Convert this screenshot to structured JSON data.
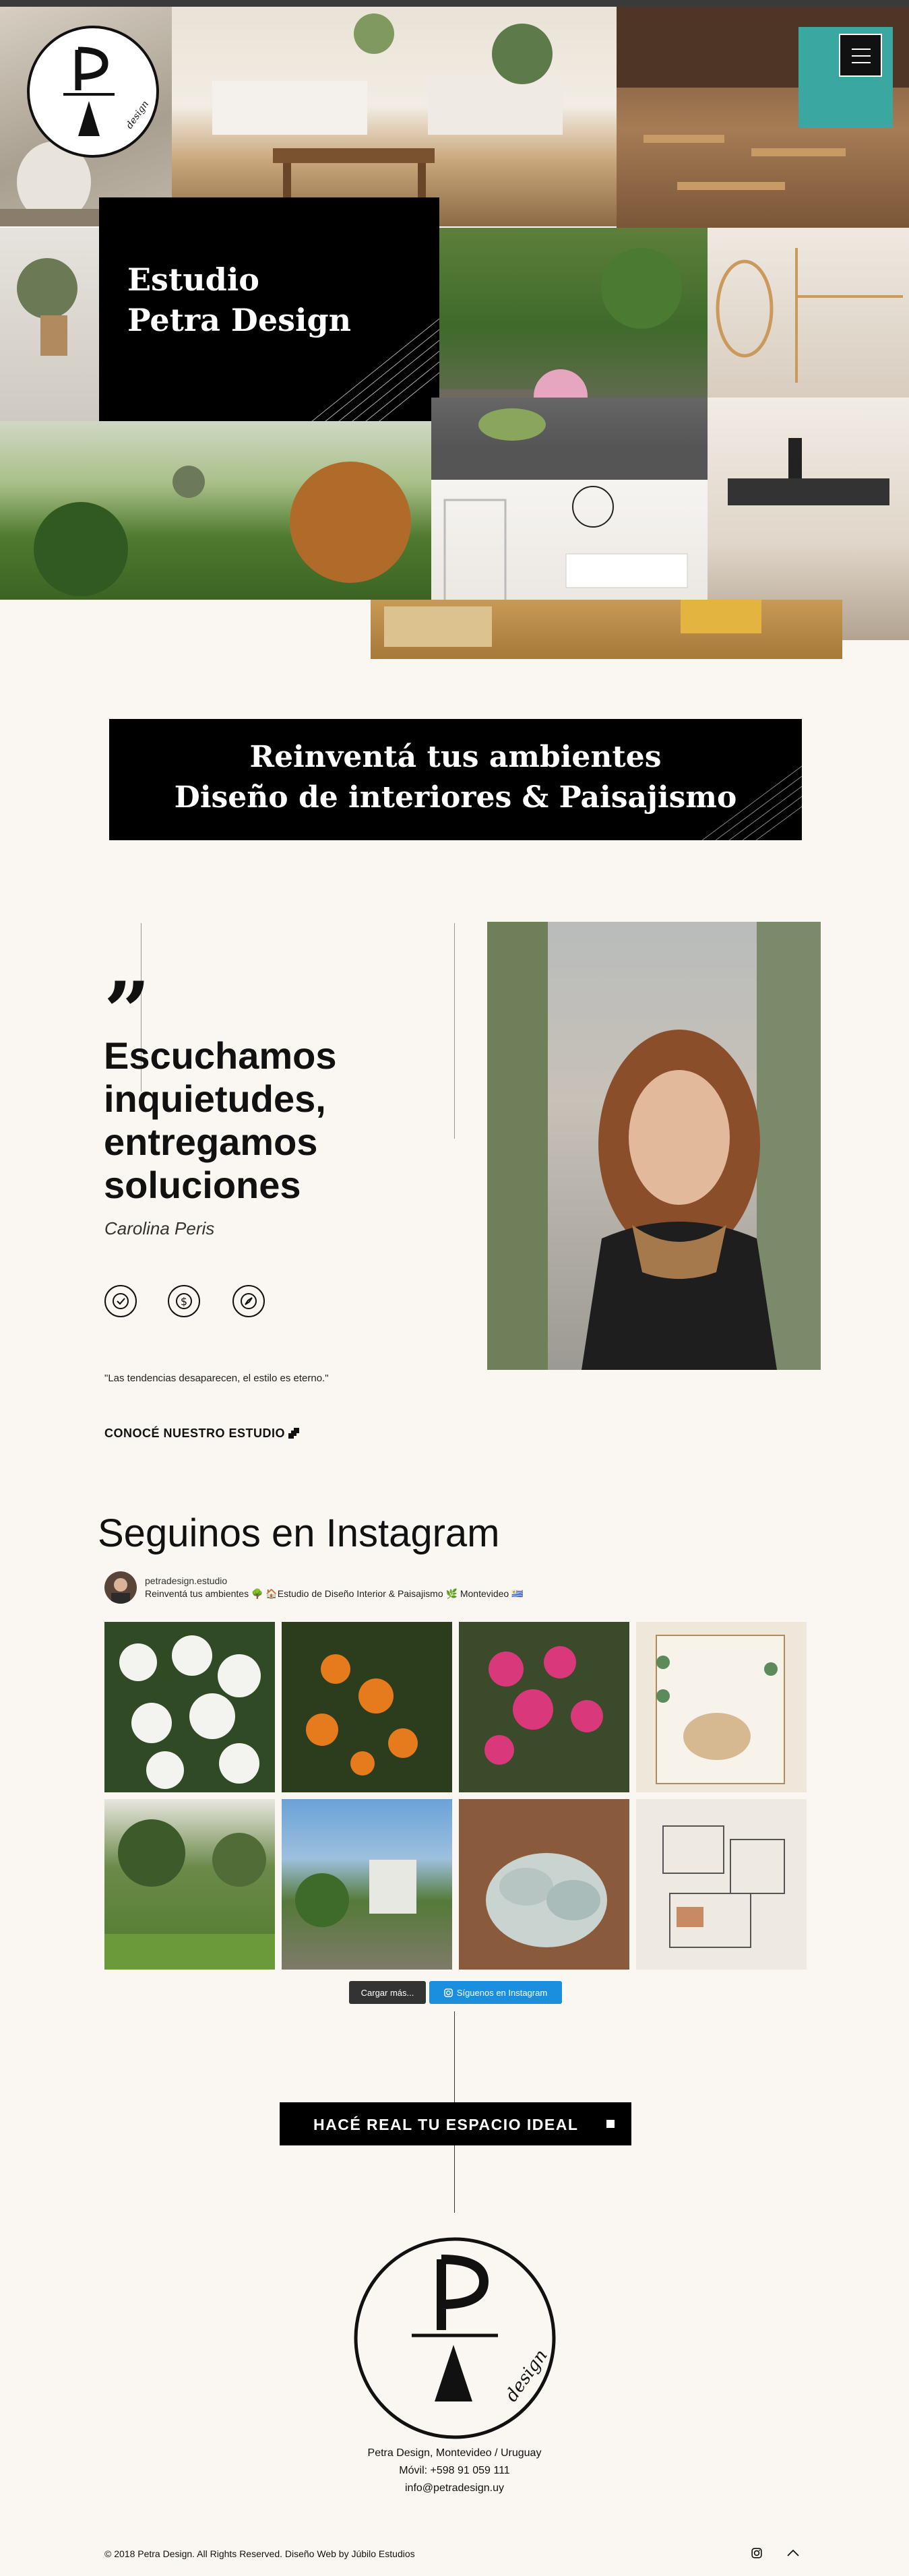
{
  "logo": {
    "letters": "PA",
    "script_text": "design"
  },
  "hero": {
    "title_line1": "Estudio",
    "title_line2": "Petra Design"
  },
  "nav": {
    "menu_icon": "hamburger-icon"
  },
  "banner": {
    "line1": "Reinventá tus ambientes",
    "line2": "Diseño de interiores & Paisajismo"
  },
  "about": {
    "headline_lines": [
      "Escuchamos",
      "inquietudes,",
      "entregamos",
      "soluciones"
    ],
    "author": "Carolina Peris",
    "icons": [
      "clock-icon",
      "dollar-icon",
      "compass-icon"
    ],
    "motto": "\"Las tendencias desaparecen, el estilo es eterno.\"",
    "cta": "CONOCÉ NUESTRO ESTUDIO"
  },
  "instagram": {
    "title": "Seguinos en Instagram",
    "username": "petradesign.estudio",
    "bio": "Reinventá tus ambientes 🌳 🏠Estudio de Diseño Interior & Paisajismo 🌿 Montevideo 🇺🇾",
    "load_more": "Cargar más...",
    "follow": "Síguenos en Instagram"
  },
  "cta": {
    "label": "HACÉ REAL TU ESPACIO IDEAL"
  },
  "footer": {
    "address": "Petra Design, Montevideo / Uruguay",
    "phone": "Móvil: +598 91 059 111",
    "email": "info@petradesign.uy",
    "copyright": "© 2018 Petra Design. All Rights Reserved. Diseño Web by Júbilo Estudios"
  },
  "colors": {
    "background": "#faf6f1",
    "black": "#000000",
    "instagram_blue": "#1a8fe0"
  }
}
